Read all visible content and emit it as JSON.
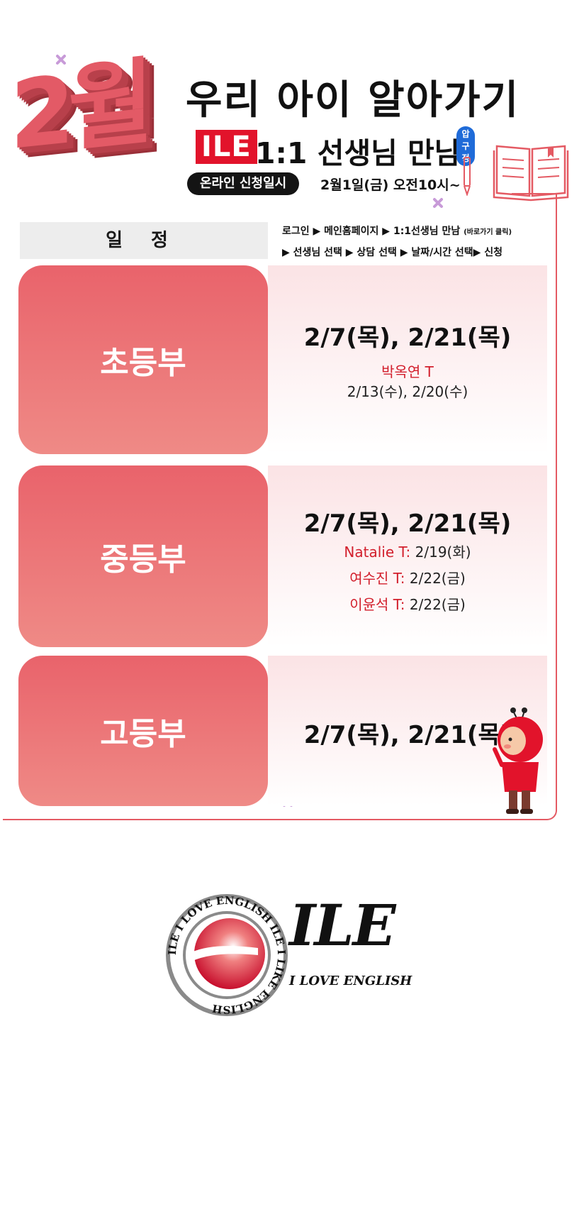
{
  "header": {
    "month": "2월",
    "title": "우리 아이 알아가기",
    "brand_badge": "ILE",
    "subtitle": "1:1 선생님 만남",
    "branch": "압구정",
    "apply_label": "온라인 신청일시",
    "apply_datetime": "2월1일(금) 오전10시~"
  },
  "schedule": {
    "label": "일정",
    "steps_line1": "로그인 ▶ 메인홈페이지 ▶ 1:1선생님 만남",
    "steps_line1_note": "(바로가기 클릭)",
    "steps_line2": "▶ 선생님 선택 ▶ 상담 선택 ▶ 날짜/시간 선택▶ 신청"
  },
  "rows": [
    {
      "grade": "초등부",
      "main_dates": "2/7(목), 2/21(목)",
      "teachers": [
        {
          "name": "박옥연 T",
          "dates": "2/13(수), 2/20(수)"
        }
      ]
    },
    {
      "grade": "중등부",
      "main_dates": "2/7(목), 2/21(목)",
      "teachers": [
        {
          "name": "Natalie T:",
          "dates": "2/19(화)"
        },
        {
          "name": "여수진 T:",
          "dates": "2/22(금)"
        },
        {
          "name": "이윤석 T:",
          "dates": "2/22(금)"
        }
      ]
    },
    {
      "grade": "고등부",
      "main_dates": "2/7(목), 2/21(목)",
      "teachers": []
    }
  ],
  "logo": {
    "wordmark": "ILE",
    "tagline": "I LOVE ENGLISH",
    "ring_text": "ILE I LOVE ENGLISH ILE I LIKE ENGLISH"
  },
  "colors": {
    "accent_red": "#e2132b",
    "grade_pink": "#e9636b",
    "panel_pink": "#fbe3e5",
    "branch_blue": "#1f6bd8"
  }
}
